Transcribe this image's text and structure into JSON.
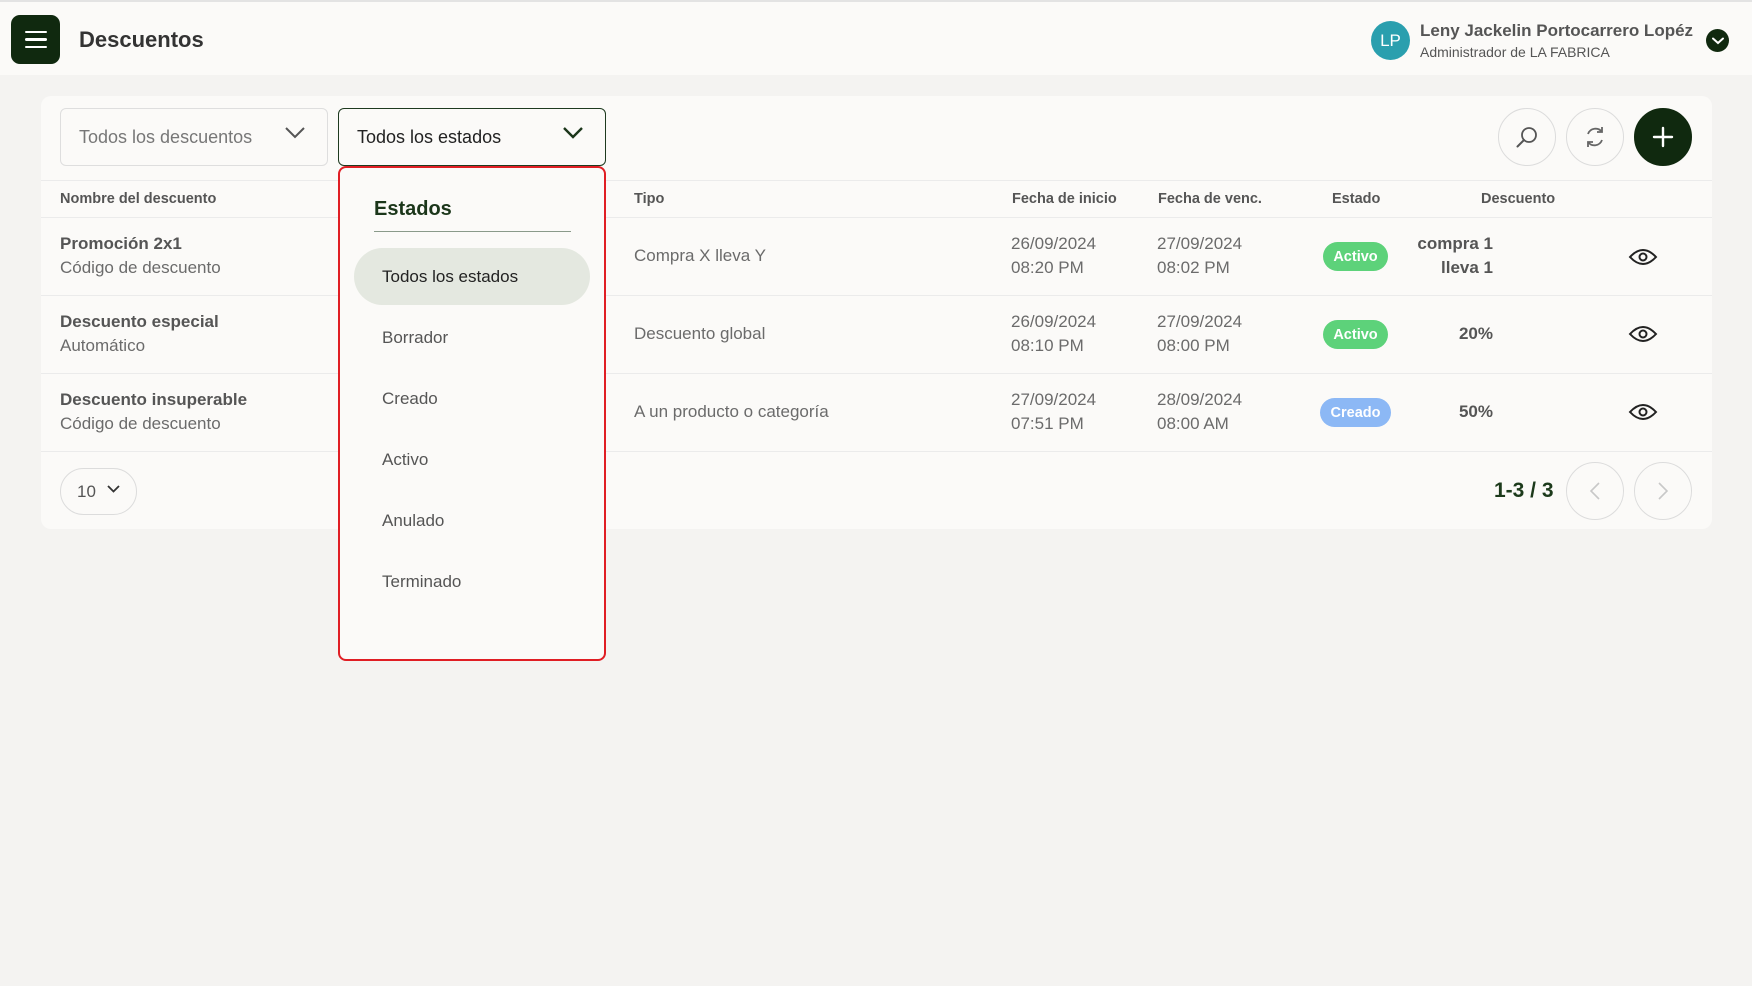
{
  "header": {
    "title": "Descuentos",
    "avatar_initials": "LP",
    "user_name": "Leny Jackelin Portocarrero Lopéz",
    "user_role": "Administrador de LA FABRICA"
  },
  "filters": {
    "discounts_select": "Todos los descuentos",
    "states_select": "Todos los estados"
  },
  "toolbar": {
    "search_icon": "search-icon",
    "refresh_icon": "refresh-icon",
    "add_icon": "plus-icon"
  },
  "table": {
    "headers": [
      "Nombre del descuento",
      "Tipo",
      "Fecha de inicio",
      "Fecha de venc.",
      "Estado",
      "Descuento"
    ],
    "rows": [
      {
        "name": "Promoción 2x1",
        "subtype": "Código de descuento",
        "type": "Compra X lleva Y",
        "start_date": "26/09/2024",
        "start_time": "08:20 PM",
        "end_date": "27/09/2024",
        "end_time": "08:02 PM",
        "status": "Activo",
        "discount_line1": "compra 1",
        "discount_line2": "lleva 1"
      },
      {
        "name": "Descuento especial",
        "subtype": "Automático",
        "type": "Descuento global",
        "start_date": "26/09/2024",
        "start_time": "08:10 PM",
        "end_date": "27/09/2024",
        "end_time": "08:00 PM",
        "status": "Activo",
        "discount_line1": "20%",
        "discount_line2": ""
      },
      {
        "name": "Descuento insuperable",
        "subtype": "Código de descuento",
        "type": "A un producto o categoría",
        "start_date": "27/09/2024",
        "start_time": "07:51 PM",
        "end_date": "28/09/2024",
        "end_time": "08:00 AM",
        "status": "Creado",
        "discount_line1": "50%",
        "discount_line2": ""
      }
    ]
  },
  "pagination": {
    "per_page": "10",
    "range": "1-3 / 3"
  },
  "dropdown": {
    "title": "Estados",
    "options": [
      "Todos los estados",
      "Borrador",
      "Creado",
      "Activo",
      "Anulado",
      "Terminado"
    ],
    "selected": "Todos los estados"
  },
  "colors": {
    "brand_dark": "#10290f",
    "active_badge": "#5dd27a",
    "created_badge": "#8cb8f5",
    "highlight_border": "#e01e24"
  }
}
